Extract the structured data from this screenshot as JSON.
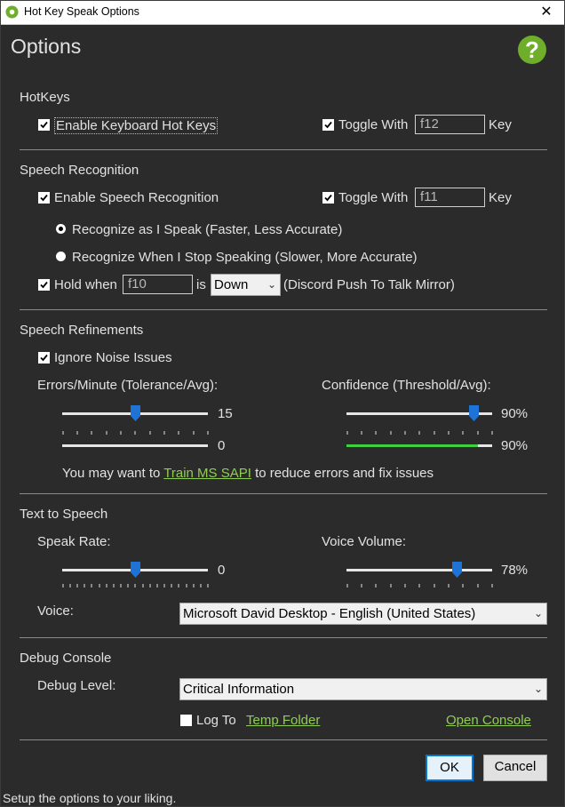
{
  "window": {
    "title": "Hot Key Speak Options",
    "close_glyph": "✕"
  },
  "heading": "Options",
  "help_glyph": "?",
  "hotkeys": {
    "section": "HotKeys",
    "enable_label": "Enable Keyboard Hot Keys",
    "toggle_label": "Toggle With",
    "toggle_value": "f12",
    "key_label": "Key"
  },
  "speech": {
    "section": "Speech Recognition",
    "enable_label": "Enable Speech Recognition",
    "toggle_label": "Toggle With",
    "toggle_value": "f11",
    "key_label": "Key",
    "radio_fast": "Recognize as I Speak (Faster, Less Accurate)",
    "radio_slow": "Recognize When I Stop Speaking (Slower, More Accurate)",
    "hold_label": "Hold when",
    "hold_value": "f10",
    "is_label": "is",
    "state_value": "Down",
    "mirror_label": "(Discord Push To Talk Mirror)"
  },
  "refine": {
    "section": "Speech Refinements",
    "ignore_label": "Ignore Noise Issues",
    "errors_label": "Errors/Minute (Tolerance/Avg):",
    "errors_value": "15",
    "errors_avg": "0",
    "conf_label": "Confidence (Threshold/Avg):",
    "conf_value": "90%",
    "conf_avg": "90%",
    "hint_pre": "You may want to",
    "hint_link": "Train MS SAPI",
    "hint_post": "to reduce errors and fix issues"
  },
  "tts": {
    "section": "Text to Speech",
    "rate_label": "Speak Rate:",
    "rate_value": "0",
    "volume_label": "Voice Volume:",
    "volume_value": "78%",
    "voice_label": "Voice:",
    "voice_value": "Microsoft David Desktop - English (United States)"
  },
  "debug": {
    "section": "Debug Console",
    "level_label": "Debug Level:",
    "level_value": "Critical Information",
    "logto_label": "Log To",
    "temp_link": "Temp Folder",
    "console_link": "Open Console"
  },
  "buttons": {
    "ok": "OK",
    "cancel": "Cancel"
  },
  "status": "Setup the options to your liking.",
  "colors": {
    "accent": "#8fce54",
    "focus": "#0078d7",
    "slider_thumb": "#1e73d6",
    "avg_bar": "#3fcf3f"
  }
}
